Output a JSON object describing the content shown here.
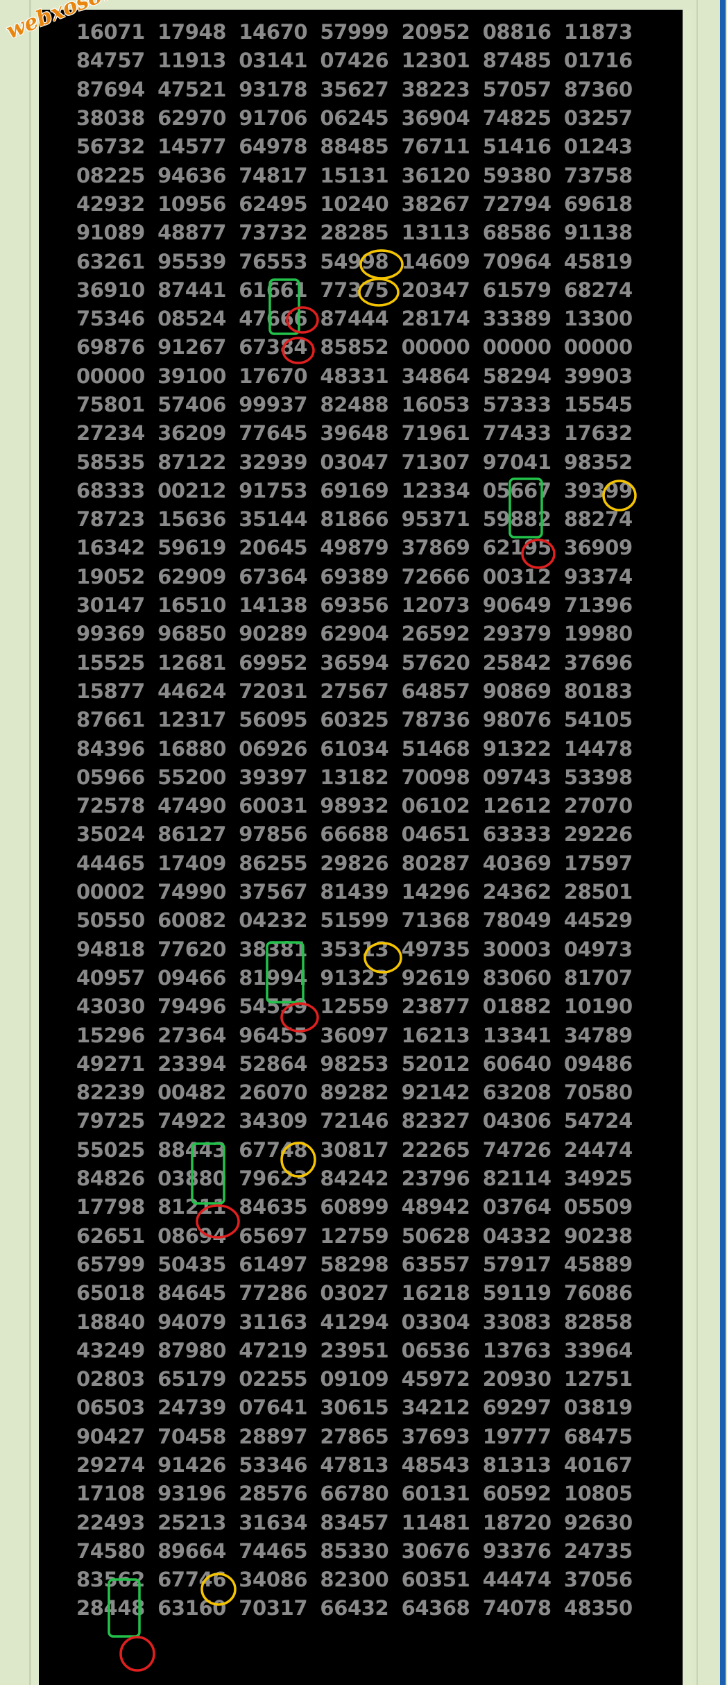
{
  "watermark": "webxoso.net",
  "colors": {
    "background": "#000000",
    "digits": "#8a8a8a",
    "green_box": "#22c24a",
    "yellow_circle": "#f5c400",
    "red_circle": "#e01f1f",
    "frame": "#dde8cb",
    "accent_bar": "#1a5fb0"
  },
  "rows": [
    [
      "16071",
      "17948",
      "14670",
      "57999",
      "20952",
      "08816",
      "11873"
    ],
    [
      "84757",
      "11913",
      "03141",
      "07426",
      "12301",
      "87485",
      "01716"
    ],
    [
      "87694",
      "47521",
      "93178",
      "35627",
      "38223",
      "57057",
      "87360"
    ],
    [
      "38038",
      "62970",
      "91706",
      "06245",
      "36904",
      "74825",
      "03257"
    ],
    [
      "56732",
      "14577",
      "64978",
      "88485",
      "76711",
      "51416",
      "01243"
    ],
    [
      "08225",
      "94636",
      "74817",
      "15131",
      "36120",
      "59380",
      "73758"
    ],
    [
      "42932",
      "10956",
      "62495",
      "10240",
      "38267",
      "72794",
      "69618"
    ],
    [
      "91089",
      "48877",
      "73732",
      "28285",
      "13113",
      "68586",
      "91138"
    ],
    [
      "63261",
      "95539",
      "76553",
      "54998",
      "14609",
      "70964",
      "45819"
    ],
    [
      "36910",
      "87441",
      "61661",
      "77375",
      "20347",
      "61579",
      "68274"
    ],
    [
      "75346",
      "08524",
      "47666",
      "87444",
      "28174",
      "33389",
      "13300"
    ],
    [
      "69876",
      "91267",
      "67384",
      "85852",
      "00000",
      "00000",
      "00000"
    ],
    [
      "00000",
      "39100",
      "17670",
      "48331",
      "34864",
      "58294",
      "39903"
    ],
    [
      "75801",
      "57406",
      "99937",
      "82488",
      "16053",
      "57333",
      "15545"
    ],
    [
      "27234",
      "36209",
      "77645",
      "39648",
      "71961",
      "77433",
      "17632"
    ],
    [
      "58535",
      "87122",
      "32939",
      "03047",
      "71307",
      "97041",
      "98352"
    ],
    [
      "68333",
      "00212",
      "91753",
      "69169",
      "12334",
      "05667",
      "39399"
    ],
    [
      "78723",
      "15636",
      "35144",
      "81866",
      "95371",
      "59882",
      "88274"
    ],
    [
      "16342",
      "59619",
      "20645",
      "49879",
      "37869",
      "62195",
      "36909"
    ],
    [
      "19052",
      "62909",
      "67364",
      "69389",
      "72666",
      "00312",
      "93374"
    ],
    [
      "30147",
      "16510",
      "14138",
      "69356",
      "12073",
      "90649",
      "71396"
    ],
    [
      "99369",
      "96850",
      "90289",
      "62904",
      "26592",
      "29379",
      "19980"
    ],
    [
      "15525",
      "12681",
      "69952",
      "36594",
      "57620",
      "25842",
      "37696"
    ],
    [
      "15877",
      "44624",
      "72031",
      "27567",
      "64857",
      "90869",
      "80183"
    ],
    [
      "87661",
      "12317",
      "56095",
      "60325",
      "78736",
      "98076",
      "54105"
    ],
    [
      "84396",
      "16880",
      "06926",
      "61034",
      "51468",
      "91322",
      "14478"
    ],
    [
      "05966",
      "55200",
      "39397",
      "13182",
      "70098",
      "09743",
      "53398"
    ],
    [
      "72578",
      "47490",
      "60031",
      "98932",
      "06102",
      "12612",
      "27070"
    ],
    [
      "35024",
      "86127",
      "97856",
      "66688",
      "04651",
      "63333",
      "29226"
    ],
    [
      "44465",
      "17409",
      "86255",
      "29826",
      "80287",
      "40369",
      "17597"
    ],
    [
      "00002",
      "74990",
      "37567",
      "81439",
      "14296",
      "24362",
      "28501"
    ],
    [
      "50550",
      "60082",
      "04232",
      "51599",
      "71368",
      "78049",
      "44529"
    ],
    [
      "94818",
      "77620",
      "38381",
      "35313",
      "49735",
      "30003",
      "04973"
    ],
    [
      "40957",
      "09466",
      "81994",
      "91323",
      "92619",
      "83060",
      "81707"
    ],
    [
      "43030",
      "79496",
      "54559",
      "12559",
      "23877",
      "01882",
      "10190"
    ],
    [
      "15296",
      "27364",
      "96455",
      "36097",
      "16213",
      "13341",
      "34789"
    ],
    [
      "49271",
      "23394",
      "52864",
      "98253",
      "52012",
      "60640",
      "09486"
    ],
    [
      "82239",
      "00482",
      "26070",
      "89282",
      "92142",
      "63208",
      "70580"
    ],
    [
      "79725",
      "74922",
      "34309",
      "72146",
      "82327",
      "04306",
      "54724"
    ],
    [
      "55025",
      "88443",
      "67748",
      "30817",
      "22265",
      "74726",
      "24474"
    ],
    [
      "84826",
      "03880",
      "79623",
      "84242",
      "23796",
      "82114",
      "34925"
    ],
    [
      "17798",
      "81211",
      "84635",
      "60899",
      "48942",
      "03764",
      "05509"
    ],
    [
      "62651",
      "08694",
      "65697",
      "12759",
      "50628",
      "04332",
      "90238"
    ],
    [
      "65799",
      "50435",
      "61497",
      "58298",
      "63557",
      "57917",
      "45889"
    ],
    [
      "65018",
      "84645",
      "77286",
      "03027",
      "16218",
      "59119",
      "76086"
    ],
    [
      "18840",
      "94079",
      "31163",
      "41294",
      "03304",
      "33083",
      "82858"
    ],
    [
      "43249",
      "87980",
      "47219",
      "23951",
      "06536",
      "13763",
      "33964"
    ],
    [
      "02803",
      "65179",
      "02255",
      "09109",
      "45972",
      "20930",
      "12751"
    ],
    [
      "06503",
      "24739",
      "07641",
      "30615",
      "34212",
      "69297",
      "03819"
    ],
    [
      "90427",
      "70458",
      "28897",
      "27865",
      "37693",
      "19777",
      "68475"
    ],
    [
      "29274",
      "91426",
      "53346",
      "47813",
      "48543",
      "81313",
      "40167"
    ],
    [
      "17108",
      "93196",
      "28576",
      "66780",
      "60131",
      "60592",
      "10805"
    ],
    [
      "22493",
      "25213",
      "31634",
      "83457",
      "11481",
      "18720",
      "92630"
    ],
    [
      "74580",
      "89664",
      "74465",
      "85330",
      "30676",
      "93376",
      "24735"
    ],
    [
      "83562",
      "67746",
      "34086",
      "82300",
      "60351",
      "44474",
      "37056"
    ],
    [
      "28448",
      "63160",
      "70317",
      "66432",
      "64368",
      "74078",
      "48350"
    ]
  ]
}
